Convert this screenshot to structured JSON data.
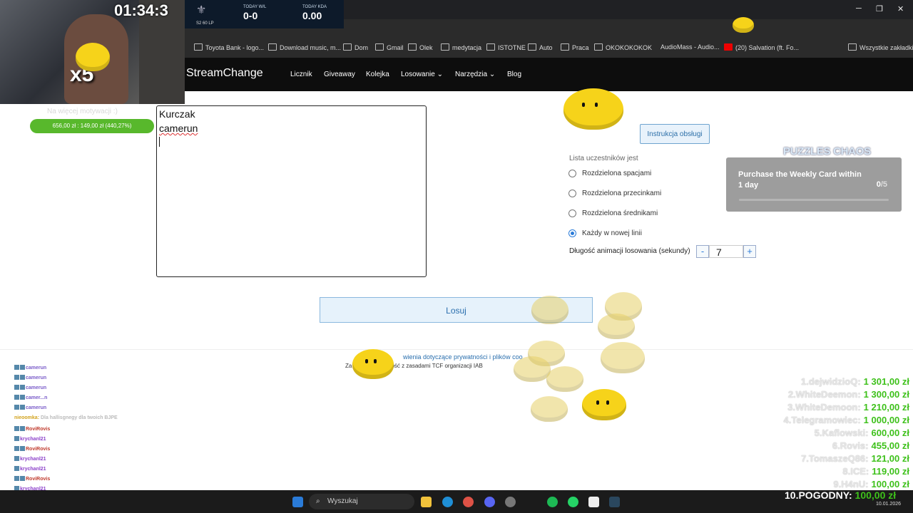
{
  "overlay": {
    "timer": "01:34:3",
    "multiplier": "x5",
    "rank": "S2 60 LP",
    "today_wl_label": "TODAY W/L",
    "today_wl_value": "0-0",
    "today_kda_label": "TODAY KDA",
    "today_kda_value": "0.00",
    "goal_title": "Na więcej motywacji :)",
    "goal_text": "656,00 zł : 149,00 zł (440,27%)"
  },
  "bookmarks": [
    "Toyota Bank - logo...",
    "Download music, m...",
    "Dom",
    "Gmail",
    "Olek",
    "medytacja",
    "ISTOTNE",
    "Auto",
    "Praca",
    "OKOKOKOKOK",
    "AudioMass - Audio...",
    "(20) Salvation (ft. Fo...",
    "Wszystkie zakładki"
  ],
  "site": {
    "logo": "StreamChange",
    "nav": [
      "Licznik",
      "Giveaway",
      "Kolejka",
      "Losowanie",
      "Narzędzia",
      "Blog"
    ]
  },
  "participants": {
    "lines": [
      "Kurczak",
      "camerun"
    ]
  },
  "panel": {
    "instruction_button": "Instrukcja obsługi",
    "list_title": "Lista uczestników jest",
    "options": [
      {
        "label": "Rozdzielona spacjami",
        "selected": false
      },
      {
        "label": "Rozdzielona przecinkami",
        "selected": false
      },
      {
        "label": "Rozdzielona średnikami",
        "selected": false
      },
      {
        "label": "Każdy w nowej linii",
        "selected": true
      }
    ],
    "duration_label": "Długość animacji losowania (sekundy)",
    "duration_value": "7",
    "minus": "-",
    "plus": "+"
  },
  "draw_button": "Losuj",
  "footer": {
    "privacy": "wienia dotyczące prywatności i plików coo",
    "consent": "Za                              Google. Zgodność z zasadami TCF organizacji IAB"
  },
  "weekly_card": {
    "logo": "PUZZLES CHAOS",
    "title": "Purchase the Weekly Card within 1 day",
    "count_done": "0",
    "count_total": "/5"
  },
  "chat": [
    {
      "user": "camerun",
      "msg": ""
    },
    {
      "user": "camerun",
      "msg": ""
    },
    {
      "user": "camerun",
      "msg": ""
    },
    {
      "user": "camer...n",
      "msg": ""
    },
    {
      "user": "camerun",
      "msg": ""
    },
    {
      "user": "nieoomka",
      "msg": "Dla hallisgnegy dla twoich BJPE"
    },
    {
      "user": "RoviRovis",
      "msg": ""
    },
    {
      "user": "krychanl21",
      "msg": ""
    },
    {
      "user": "RoviRovis",
      "msg": ""
    },
    {
      "user": "krychanl21",
      "msg": ""
    },
    {
      "user": "krychanl21",
      "msg": ""
    },
    {
      "user": "RoviRovis",
      "msg": ""
    },
    {
      "user": "krychanl21",
      "msg": ""
    },
    {
      "user": "RoviRovis",
      "msg": ""
    }
  ],
  "leaderboard": [
    {
      "name": "1.dejwidzioQ:",
      "amount": "1 301,00 zł"
    },
    {
      "name": "2.WhiteDeemon:",
      "amount": "1 300,00 zł"
    },
    {
      "name": "3.WhiteDemoon:",
      "amount": "1 210,00 zł"
    },
    {
      "name": "4.Telegramowiec:",
      "amount": "1 000,00 zł"
    },
    {
      "name": "5.Kaflowski:",
      "amount": "600,00 zł"
    },
    {
      "name": "6.Rovis:",
      "amount": "455,00 zł"
    },
    {
      "name": "7.TomaszeQ86:",
      "amount": "121,00 zł"
    },
    {
      "name": "8.ICE:",
      "amount": "119,00 zł"
    },
    {
      "name": "9.H4nU:",
      "amount": "100,00 zł"
    }
  ],
  "ticker": {
    "name": "10.POGODNY:",
    "amount": "100,00 zł"
  },
  "taskbar": {
    "search": "Wyszukaj",
    "date": "10.01.2026"
  },
  "colors": {
    "accent": "#2a7bd8",
    "goal_bar": "#58b82c",
    "leaderboard_amount": "#3ec11b",
    "bee": "#f6d31a"
  }
}
